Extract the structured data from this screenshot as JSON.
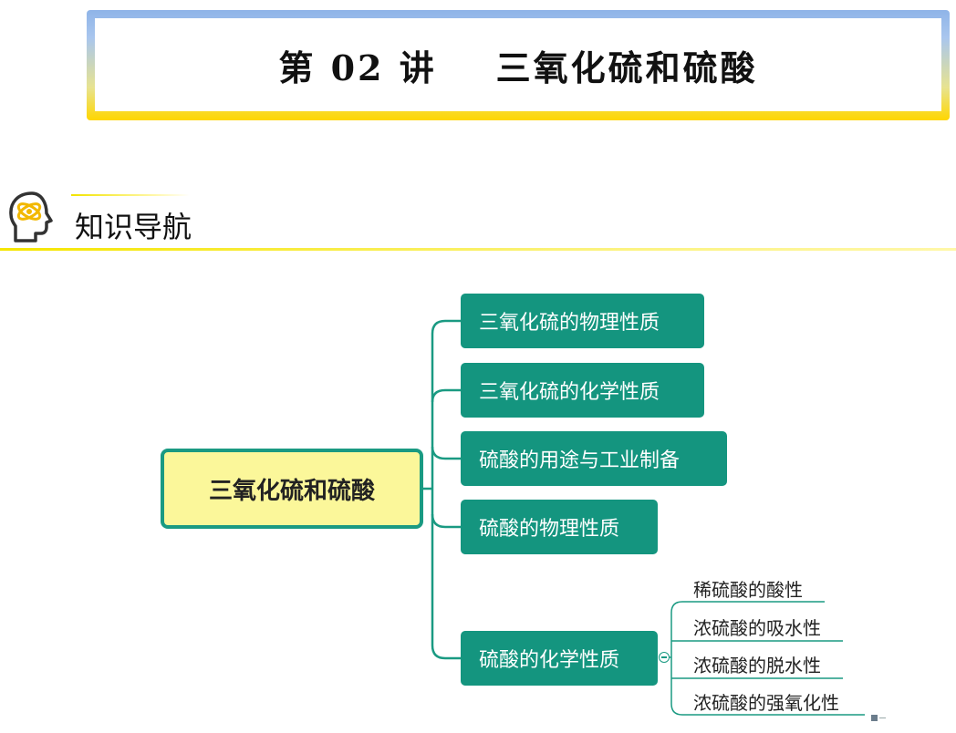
{
  "header": {
    "title": "第 02 讲    三氧化硫和硫酸"
  },
  "section": {
    "icon": "brain-head-icon",
    "title": "知识导航"
  },
  "mindmap": {
    "root": "三氧化硫和硫酸",
    "branches": [
      "三氧化硫的物理性质",
      "三氧化硫的化学性质",
      "硫酸的用途与工业制备",
      "硫酸的物理性质",
      "硫酸的化学性质"
    ],
    "leaves": [
      "稀硫酸的酸性",
      "浓硫酸的吸水性",
      "浓硫酸的脱水性",
      "浓硫酸的强氧化性"
    ]
  },
  "colors": {
    "node_green": "#14957f",
    "root_fill": "#fbf79a",
    "accent_yellow": "#f5e600",
    "banner_blue": "#8fb4e8"
  }
}
